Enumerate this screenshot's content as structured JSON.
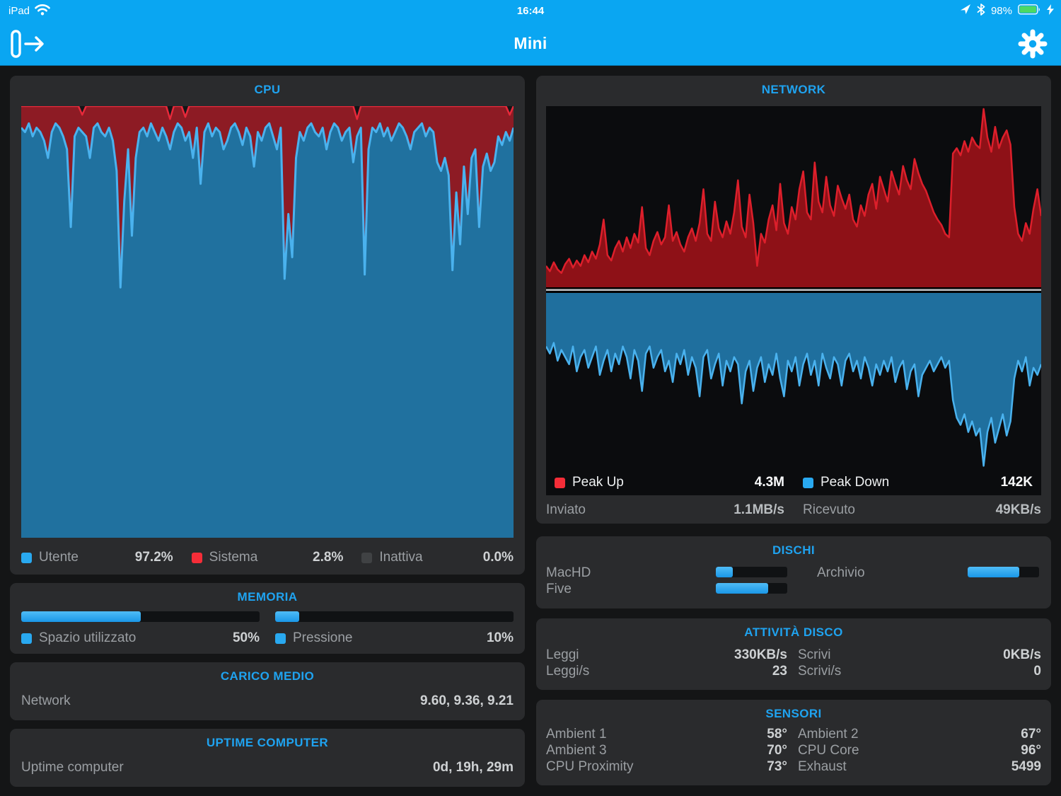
{
  "colors": {
    "nav_blue": "#0aa6f2",
    "accent_blue": "#1fa3f0",
    "battery_green": "#4cd964",
    "cpu_user_fill": "#20719f",
    "cpu_user_line": "#4ab2ee",
    "cpu_system_fill": "#8d1b24",
    "cpu_system_line": "#e6293a",
    "net_up_fill": "#8e1117",
    "net_up_line": "#dd1f2b",
    "net_down_fill": "#1f6f9e",
    "net_down_line": "#4ab2ee"
  },
  "status_bar": {
    "device": "iPad",
    "time": "16:44",
    "battery_percent": "98%"
  },
  "nav_bar": {
    "title": "Mini"
  },
  "panels": {
    "cpu": {
      "title": "CPU",
      "legend": [
        {
          "label": "Utente",
          "value": "97.2%",
          "color": "#29a9f0"
        },
        {
          "label": "Sistema",
          "value": "2.8%",
          "color": "#f52d38"
        },
        {
          "label": "Inattiva",
          "value": "0.0%",
          "color": "#404244"
        }
      ]
    },
    "memoria": {
      "title": "MEMORIA",
      "bars": [
        {
          "label": "Spazio utilizzato",
          "value": "50%",
          "percent": 50,
          "color": "#29a9f0"
        },
        {
          "label": "Pressione",
          "value": "10%",
          "percent": 10,
          "color": "#29a9f0"
        }
      ]
    },
    "carico": {
      "title": "CARICO MEDIO",
      "rows": [
        {
          "label": "Network",
          "value": "9.60, 9.36, 9.21"
        }
      ]
    },
    "uptime": {
      "title": "UPTIME COMPUTER",
      "rows": [
        {
          "label": "Uptime computer",
          "value": "0d, 19h, 29m"
        }
      ]
    },
    "network": {
      "title": "NETWORK",
      "legend": [
        {
          "label": "Peak Up",
          "value": "4.3M",
          "color": "#f52d38"
        },
        {
          "label": "Peak Down",
          "value": "142K",
          "color": "#29a9f0"
        }
      ],
      "footer": [
        {
          "label": "Inviato",
          "value": "1.1MB/s"
        },
        {
          "label": "Ricevuto",
          "value": "49KB/s"
        }
      ]
    },
    "dischi": {
      "title": "DISCHI",
      "disks": [
        {
          "label": "MacHD",
          "percent": 24
        },
        {
          "label": "Five",
          "percent": 73
        },
        {
          "label": "Archivio",
          "percent": 72
        }
      ]
    },
    "attivita": {
      "title": "ATTIVITÀ DISCO",
      "cells": [
        {
          "label": "Leggi",
          "value": "330KB/s"
        },
        {
          "label": "Scrivi",
          "value": "0KB/s"
        },
        {
          "label": "Leggi/s",
          "value": "23"
        },
        {
          "label": "Scrivi/s",
          "value": "0"
        }
      ]
    },
    "sensori": {
      "title": "SENSORI",
      "cells": [
        {
          "label": "Ambient 1",
          "value": "58°"
        },
        {
          "label": "Ambient 2",
          "value": "67°"
        },
        {
          "label": "Ambient 3",
          "value": "70°"
        },
        {
          "label": "CPU Core",
          "value": "96°"
        },
        {
          "label": "CPU Proximity",
          "value": "73°"
        },
        {
          "label": "Exhaust",
          "value": "5499"
        }
      ]
    }
  },
  "chart_data": [
    {
      "type": "area",
      "title": "CPU",
      "ylabel": "percent",
      "ylim": [
        0,
        100
      ],
      "legend_position": "bottom",
      "grid": false,
      "series": [
        {
          "name": "Utente (user %)",
          "values": [
            95,
            94,
            96,
            93,
            95,
            94,
            92,
            88,
            94,
            96,
            95,
            93,
            90,
            72,
            93,
            95,
            94,
            93,
            88,
            95,
            96,
            94,
            93,
            95,
            92,
            85,
            58,
            78,
            90,
            70,
            88,
            94,
            95,
            93,
            96,
            94,
            92,
            95,
            93,
            90,
            94,
            96,
            95,
            92,
            94,
            88,
            95,
            82,
            94,
            96,
            93,
            95,
            94,
            90,
            92,
            95,
            96,
            94,
            91,
            95,
            93,
            86,
            94,
            92,
            95,
            96,
            93,
            90,
            95,
            60,
            75,
            65,
            88,
            94,
            92,
            95,
            96,
            94,
            93,
            95,
            90,
            94,
            96,
            95,
            92,
            94,
            95,
            87,
            93,
            95,
            61,
            90,
            95,
            94,
            96,
            93,
            95,
            92,
            94,
            96,
            95,
            93,
            90,
            94,
            95,
            96,
            93,
            95,
            94,
            87,
            85,
            88,
            84,
            62,
            80,
            68,
            86,
            75,
            88,
            90,
            72,
            86,
            89,
            85,
            87,
            93,
            91,
            94,
            92,
            95
          ]
        },
        {
          "name": "Utente+Sistema (totale %)",
          "length": 130,
          "default": 100,
          "overrides": {
            "16": 98,
            "39": 97,
            "43": 97.5,
            "88": 97,
            "128": 98
          }
        }
      ],
      "summary": {
        "Utente": "97.2%",
        "Sistema": "2.8%",
        "Inattiva": "0.0%"
      }
    },
    {
      "type": "area",
      "title": "NETWORK",
      "orientation": "mirrored (up above divider, down below)",
      "ylim": [
        0,
        100
      ],
      "grid": false,
      "series": [
        {
          "name": "Upload (Peak Up 4.3M)",
          "values": [
            12,
            9,
            14,
            10,
            8,
            13,
            16,
            11,
            15,
            12,
            18,
            14,
            20,
            16,
            24,
            38,
            18,
            15,
            22,
            26,
            20,
            28,
            22,
            30,
            25,
            45,
            22,
            18,
            26,
            31,
            24,
            28,
            46,
            26,
            31,
            24,
            20,
            28,
            33,
            26,
            36,
            55,
            30,
            26,
            48,
            33,
            28,
            37,
            30,
            42,
            60,
            34,
            28,
            52,
            36,
            12,
            30,
            25,
            38,
            46,
            32,
            58,
            36,
            30,
            45,
            38,
            55,
            65,
            42,
            38,
            70,
            48,
            42,
            62,
            46,
            40,
            57,
            50,
            44,
            52,
            38,
            34,
            46,
            40,
            52,
            58,
            44,
            62,
            55,
            48,
            65,
            58,
            52,
            68,
            60,
            55,
            72,
            64,
            58,
            54,
            48,
            42,
            38,
            35,
            30,
            28,
            75,
            78,
            74,
            82,
            76,
            84,
            80,
            78,
            100,
            84,
            76,
            90,
            78,
            84,
            88,
            80,
            45,
            30,
            26,
            36,
            30,
            44,
            55,
            40
          ]
        },
        {
          "name": "Download (Peak Down 142K)",
          "values": [
            30,
            34,
            28,
            38,
            32,
            36,
            40,
            30,
            44,
            36,
            32,
            42,
            36,
            30,
            46,
            38,
            32,
            44,
            34,
            40,
            30,
            36,
            48,
            32,
            38,
            55,
            34,
            30,
            42,
            36,
            32,
            44,
            38,
            50,
            34,
            40,
            32,
            46,
            36,
            42,
            58,
            36,
            32,
            48,
            40,
            34,
            52,
            38,
            44,
            36,
            40,
            62,
            44,
            38,
            55,
            42,
            36,
            50,
            40,
            46,
            34,
            48,
            58,
            38,
            44,
            36,
            52,
            40,
            34,
            46,
            38,
            52,
            34,
            42,
            48,
            36,
            40,
            52,
            38,
            34,
            44,
            38,
            48,
            36,
            42,
            52,
            40,
            46,
            38,
            44,
            36,
            50,
            42,
            38,
            54,
            44,
            40,
            58,
            46,
            42,
            38,
            44,
            40,
            36,
            42,
            38,
            60,
            70,
            74,
            68,
            78,
            72,
            80,
            76,
            97,
            78,
            70,
            84,
            76,
            68,
            80,
            72,
            48,
            38,
            44,
            36,
            52,
            42,
            46,
            40
          ]
        }
      ],
      "summary": {
        "Peak Up": "4.3M",
        "Peak Down": "142K",
        "Inviato": "1.1MB/s",
        "Ricevuto": "49KB/s"
      }
    }
  ]
}
